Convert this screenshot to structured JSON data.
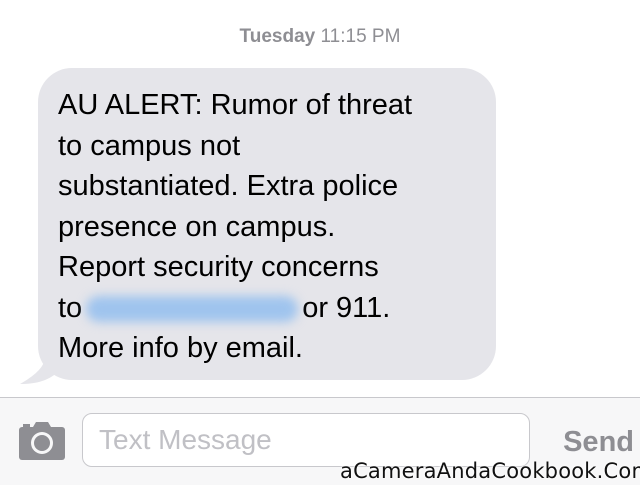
{
  "header": {
    "timestamp_day": "Tuesday",
    "timestamp_time": "11:15 PM"
  },
  "message": {
    "lines": [
      "AU ALERT: Rumor of threat",
      "to campus not",
      "substantiated. Extra police",
      "presence on campus.",
      "Report security concerns"
    ],
    "line6_prefix": "to",
    "line6_suffix": "or 911.",
    "line7": "More info by email.",
    "bubble_color": "#e5e5ea",
    "redacted_color": "#9fc4ee"
  },
  "composer": {
    "camera_icon": "camera-icon",
    "input_placeholder": "Text Message",
    "input_value": "",
    "send_label": "Send"
  },
  "watermark": {
    "text": "aCameraAndaCookbook.Com"
  }
}
